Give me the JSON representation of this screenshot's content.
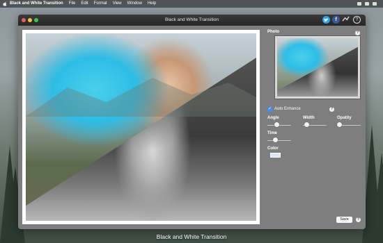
{
  "menubar": {
    "app_name": "Black and White Transition",
    "items": [
      "File",
      "Edit",
      "Format",
      "View",
      "Window",
      "Help"
    ]
  },
  "window": {
    "title": "Black and White Transition"
  },
  "toolbar_icons": [
    "twitter-icon",
    "facebook-icon",
    "share-icon",
    "help-icon"
  ],
  "panel": {
    "photo_label": "Photo",
    "auto_enhance_label": "Auto Enhance",
    "auto_enhance_checked": true,
    "angle_label": "Angle",
    "width_label": "Width",
    "opacity_label": "Opatity",
    "time_label": "Time",
    "color_label": "Color",
    "color_value": "#dbe6f7",
    "help_glyph": "?",
    "save_label": "Save"
  },
  "caption": "Black and White Transition",
  "colors": {
    "accent_blue": "#3f8ff0",
    "window_bg": "#7e7e7e",
    "titlebar_bg": "#2e2e2e",
    "twitter": "#2aa3ef",
    "facebook": "#3b5998"
  }
}
